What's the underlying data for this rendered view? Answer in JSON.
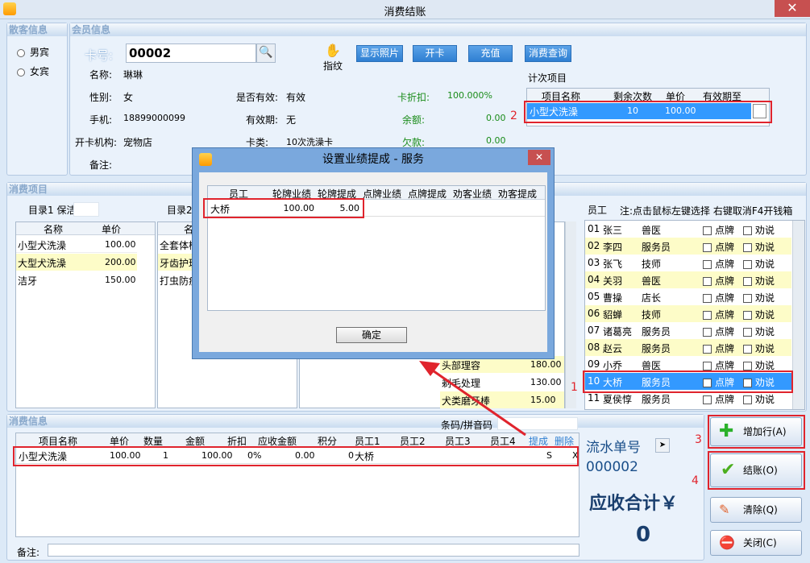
{
  "window": {
    "title": "消费结账",
    "close": "✕"
  },
  "guest": {
    "header": "散客信息",
    "gender_male": "男宾",
    "gender_female": "女宾"
  },
  "member": {
    "header": "会员信息",
    "card_label": "卡号:",
    "card_value": "00002",
    "fingerprint": "指纹",
    "buttons": [
      "显示照片",
      "开卡",
      "充值",
      "消费查询"
    ],
    "name_label": "名称:",
    "name_value": "琳琳",
    "gender_label": "性别:",
    "gender_value": "女",
    "valid_label": "是否有效:",
    "valid_value": "有效",
    "discount_label": "卡折扣:",
    "discount_value": "100.000%",
    "phone_label": "手机:",
    "phone_value": "18899000099",
    "expiry_label": "有效期:",
    "expiry_value": "无",
    "balance_label": "余额:",
    "balance_value": "0.00",
    "branch_label": "开卡机构:",
    "branch_value": "宠物店",
    "cardtype_label": "卡类:",
    "cardtype_value": "10次洗澡卡",
    "debt_label": "欠款:",
    "debt_value": "0.00",
    "note_label": "备注:"
  },
  "count_items": {
    "title": "计次项目",
    "headers": [
      "项目名称",
      "剩余次数",
      "单价",
      "有效期至"
    ],
    "row": {
      "name": "小型犬洗澡",
      "remaining": "10",
      "price": "100.00",
      "expiry": ""
    }
  },
  "consume_items": {
    "header": "消费项目",
    "cat1_label": "目录1",
    "cat1_value": "保洁",
    "cat1_headers": [
      "名称",
      "单价"
    ],
    "cat1_rows": [
      {
        "name": "小型犬洗澡",
        "price": "100.00"
      },
      {
        "name": "大型犬洗澡",
        "price": "200.00"
      },
      {
        "name": "洁牙",
        "price": "150.00"
      }
    ],
    "cat2_label": "目录2",
    "cat2_header_partial": "名",
    "cat2_rows": [
      "全套体检",
      "牙齿护理",
      "打虫防疫"
    ],
    "cat3_rows": [
      {
        "name": "头部理容",
        "price": "180.00"
      },
      {
        "name": "剃毛处理",
        "price": "130.00"
      },
      {
        "name": "犬类磨牙棒",
        "price": "15.00"
      }
    ]
  },
  "staff": {
    "label": "员工",
    "hint": "注:点击鼠标左键选择 右键取消F4开钱箱",
    "opt1": "点牌",
    "opt2": "劝说",
    "rows": [
      {
        "no": "01",
        "name": "张三",
        "role": "兽医"
      },
      {
        "no": "02",
        "name": "李四",
        "role": "服务员"
      },
      {
        "no": "03",
        "name": "张飞",
        "role": "技师"
      },
      {
        "no": "04",
        "name": "关羽",
        "role": "兽医"
      },
      {
        "no": "05",
        "name": "曹操",
        "role": "店长"
      },
      {
        "no": "06",
        "name": "貂蝉",
        "role": "技师"
      },
      {
        "no": "07",
        "name": "诸葛亮",
        "role": "服务员"
      },
      {
        "no": "08",
        "name": "赵云",
        "role": "服务员"
      },
      {
        "no": "09",
        "name": "小乔",
        "role": "兽医"
      },
      {
        "no": "10",
        "name": "大桥",
        "role": "服务员"
      },
      {
        "no": "11",
        "name": "夏侯惇",
        "role": "服务员"
      }
    ]
  },
  "consume_info": {
    "header": "消费信息",
    "barcode_label": "条码/拼音码",
    "headers": [
      "项目名称",
      "单价",
      "数量",
      "金额",
      "折扣",
      "应收金额",
      "积分",
      "员工1",
      "员工2",
      "员工3",
      "员工4",
      "提成",
      "删除"
    ],
    "row": {
      "name": "小型犬洗澡",
      "price": "100.00",
      "qty": "1",
      "amount": "100.00",
      "discount": "0%",
      "receivable": "0.00",
      "points": "0",
      "staff1": "大桥",
      "commission": "S",
      "delete": "X"
    },
    "note_label": "备注:"
  },
  "summary": {
    "serial_label": "流水单号",
    "serial_value": "000002",
    "total_label": "应收合计￥",
    "total_value": "0"
  },
  "actions": {
    "add_row": "增加行(A)",
    "checkout": "结账(O)",
    "clear": "清除(Q)",
    "close": "关闭(C)"
  },
  "dialog": {
    "title": "设置业绩提成 - 服务",
    "close": "✕",
    "headers": [
      "员工",
      "轮牌业绩",
      "轮牌提成",
      "点牌业绩",
      "点牌提成",
      "劝客业绩",
      "劝客提成"
    ],
    "row": {
      "staff": "大桥",
      "perf": "100.00",
      "comm": "5.00"
    },
    "ok": "确定"
  },
  "annotations": [
    "1",
    "2",
    "3",
    "4"
  ],
  "colors": {
    "annotation_red": "#e0242d",
    "selection_blue": "#3399ff",
    "accent_blue": "#2f7fd2"
  }
}
